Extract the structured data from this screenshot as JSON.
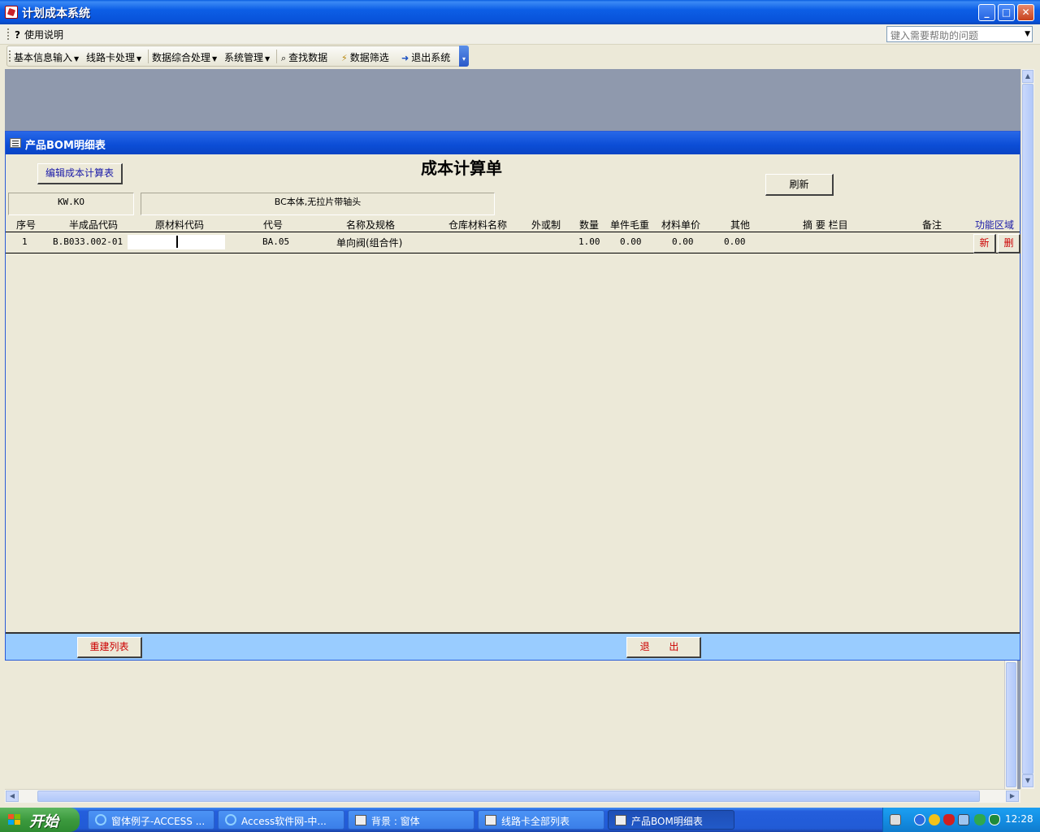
{
  "window": {
    "title": "计划成本系统"
  },
  "menubar": {
    "help_label": "使用说明",
    "help_placeholder": "键入需要帮助的问题"
  },
  "toolbar": {
    "items": [
      "基本信息输入",
      "线路卡处理",
      "数据综合处理",
      "系统管理"
    ],
    "find_label": "查找数据",
    "filter_label": "数据筛选",
    "exit_label": "退出系统"
  },
  "form": {
    "title": "产品BOM明细表",
    "heading": "成本计算单",
    "edit_button": "编辑成本计算表",
    "refresh_button": "刷新",
    "product_code": "KW.KO",
    "product_desc": "BC本体,无拉片带轴头",
    "columns": [
      "序号",
      "半成品代码",
      "原材料代码",
      "代号",
      "名称及规格",
      "仓库材料名称",
      "外或制",
      "数量",
      "单件毛重",
      "材料单价",
      "其他",
      "摘 要 栏目",
      "备注",
      "功能区域"
    ],
    "rows": [
      {
        "seq": "1",
        "semi_code": "B.B033.002-01",
        "raw_code": "",
        "code": "BA.05",
        "name": "单向阀(组合件)",
        "warehouse_name": "",
        "ext": "",
        "qty": "1.00",
        "weight": "0.00",
        "price": "0.00",
        "other": "0.00",
        "summary": "",
        "note": ""
      }
    ],
    "row_new": "新",
    "row_delete": "删",
    "rebuild_button": "重建列表",
    "exit_button": "退 出"
  },
  "taskbar": {
    "start_label": "开始",
    "tasks": [
      "窗体例子-ACCESS ...",
      "Access软件网-中...",
      "背景 : 窗体",
      "线路卡全部列表",
      "产品BOM明细表"
    ],
    "clock": "12:28"
  }
}
